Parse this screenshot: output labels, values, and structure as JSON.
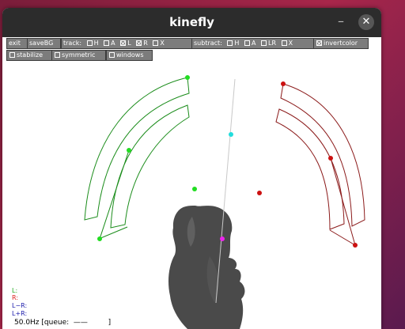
{
  "window": {
    "title": "kinefly",
    "minimize_glyph": "–",
    "close_glyph": "✕"
  },
  "toolbar": {
    "exit_label": "exit",
    "savebg_label": "saveBG",
    "tracking": {
      "label": "track:",
      "items": [
        {
          "label": "H",
          "checked": false
        },
        {
          "label": "A",
          "checked": false
        },
        {
          "label": "L",
          "checked": true
        },
        {
          "label": "R",
          "checked": true
        },
        {
          "label": "X",
          "checked": false
        }
      ]
    },
    "subtract": {
      "label": "subtract:",
      "items": [
        {
          "label": "H",
          "checked": false
        },
        {
          "label": "A",
          "checked": false
        },
        {
          "label": "LR",
          "checked": false
        },
        {
          "label": "X",
          "checked": false
        }
      ]
    },
    "invertcolor": {
      "label": "invertcolor",
      "checked": true
    },
    "stabilize": {
      "label": "stabilize",
      "checked": false
    },
    "symmetric": {
      "label": "symmetric",
      "checked": false
    },
    "windows": {
      "label": "windows",
      "checked": false
    }
  },
  "legend": {
    "left": "L:",
    "right": "R:",
    "l_minus_r": "L−R:",
    "l_plus_r": "L+R:"
  },
  "status": {
    "rate": "50.0Hz",
    "queue": "[queue:  ——         ]"
  },
  "colors": {
    "left_wing": "#1a8c1a",
    "left_point": "#22dd22",
    "right_wing": "#8b1a1a",
    "right_point": "#cc1111",
    "axis_point_top": "#22dddd",
    "axis_point_bottom": "#ee22ee",
    "legend_left": "#22aa22",
    "legend_right": "#dd2222",
    "legend_diff": "#1a1aaa",
    "legend_sum": "#1a1aaa"
  }
}
